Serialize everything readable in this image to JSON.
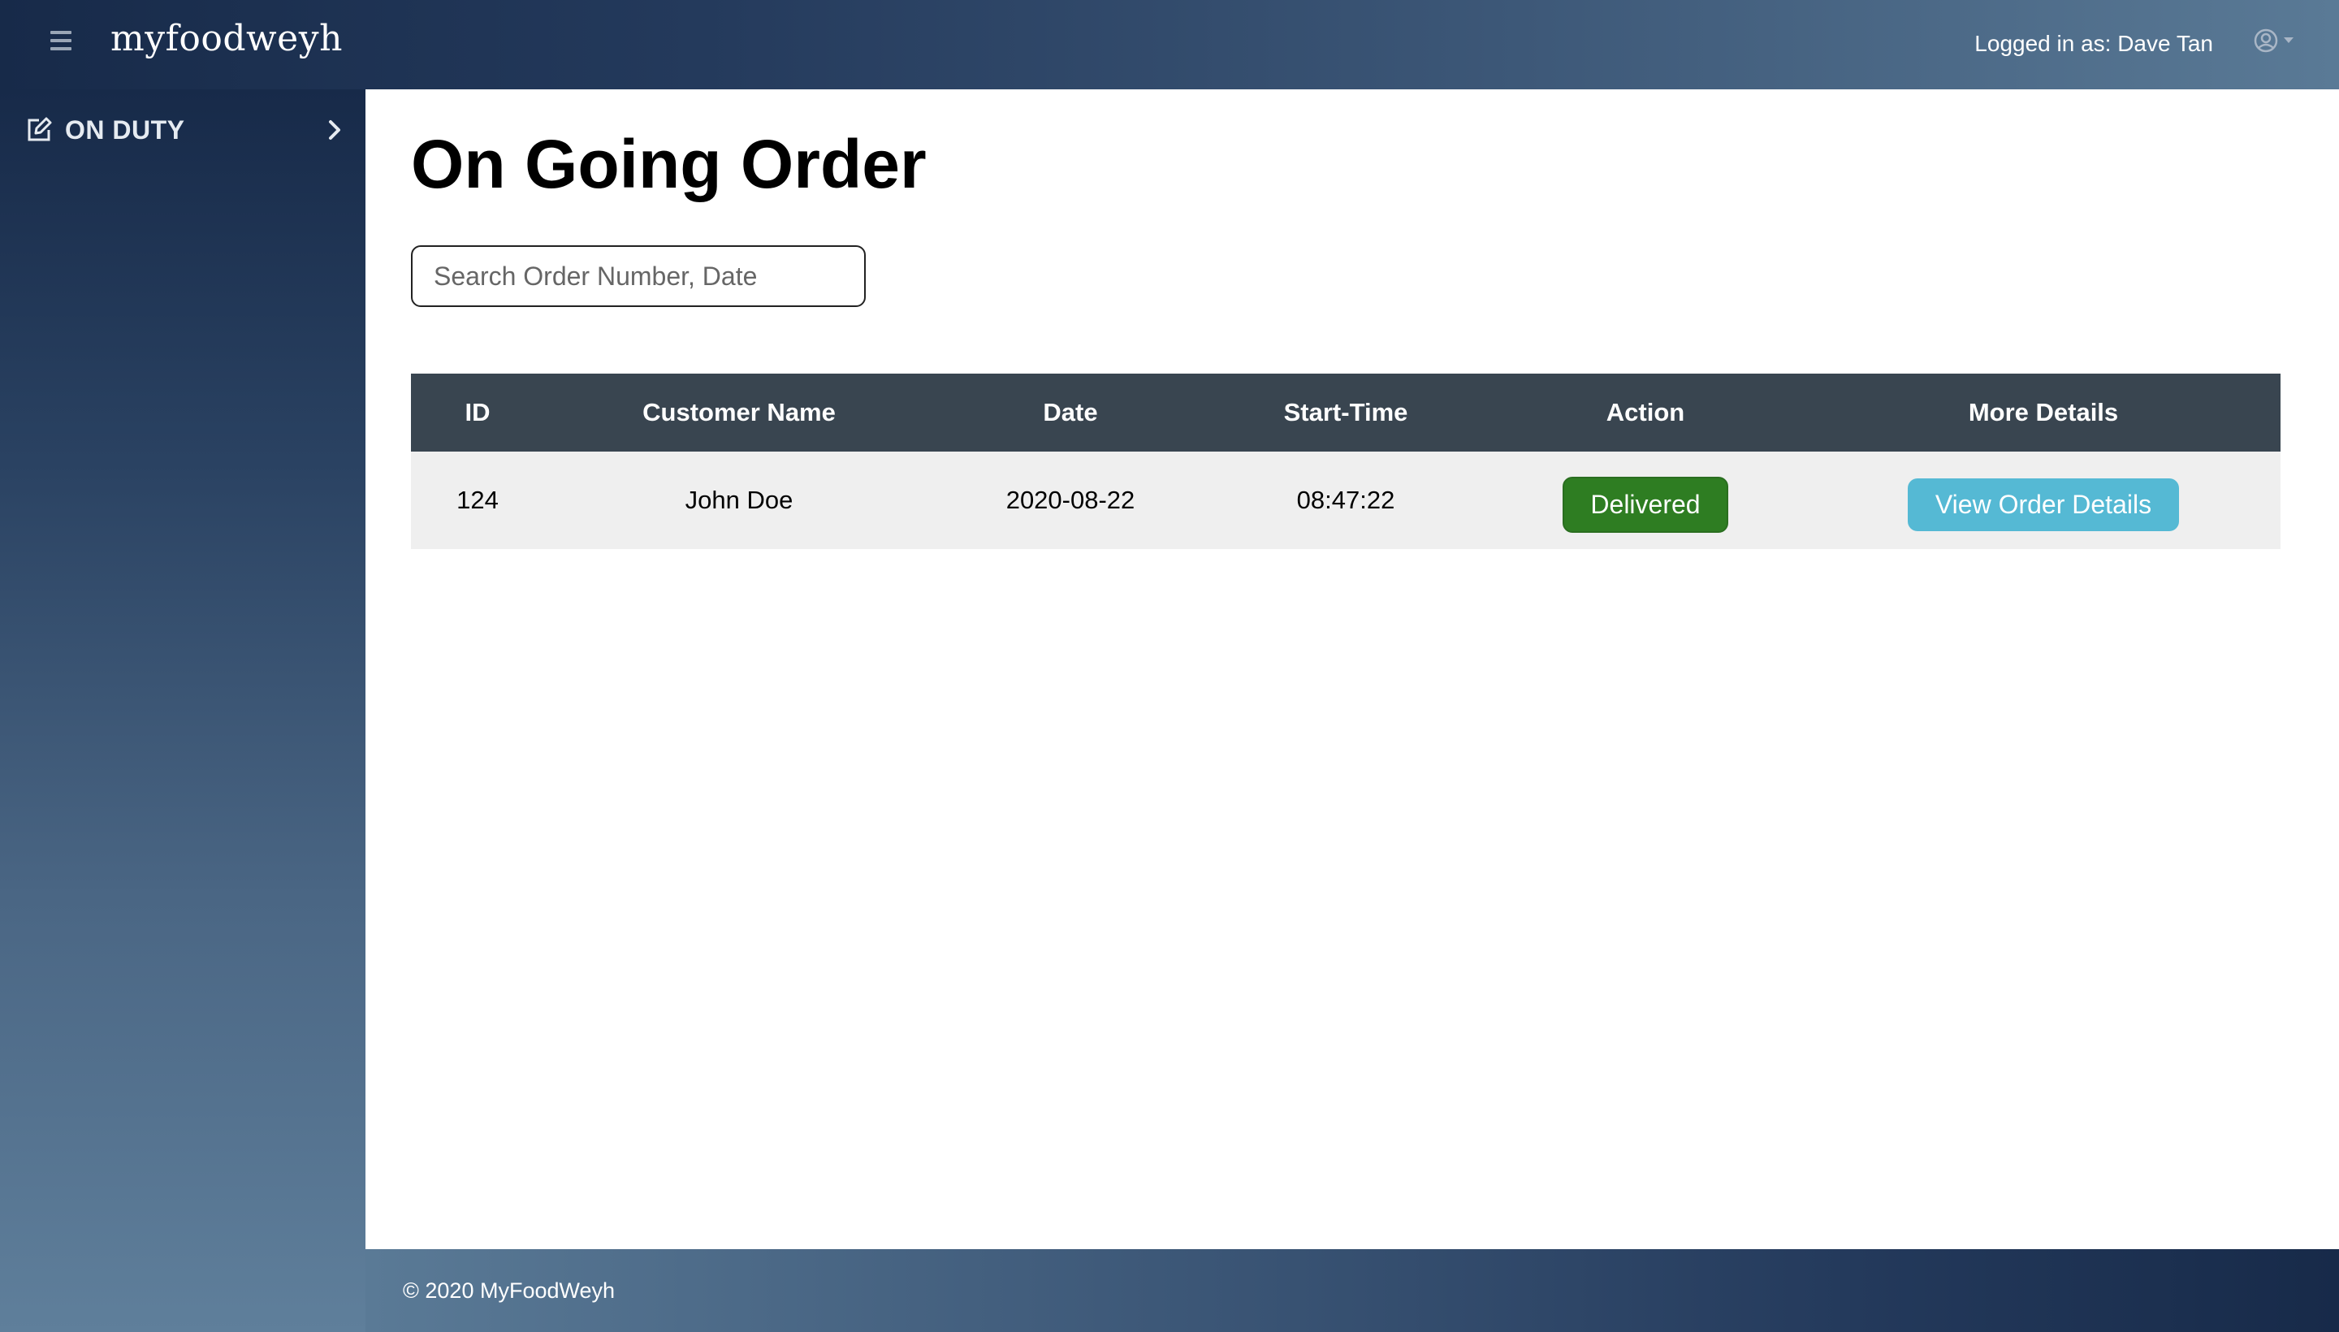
{
  "header": {
    "brand": "myfoodweyh",
    "logged_in_text": "Logged in as: Dave Tan"
  },
  "sidebar": {
    "items": [
      {
        "label": "ON DUTY",
        "icon": "edit-icon"
      }
    ]
  },
  "main": {
    "title": "On Going Order",
    "search_placeholder": "Search Order Number, Date",
    "table": {
      "columns": [
        "ID",
        "Customer Name",
        "Date",
        "Start-Time",
        "Action",
        "More Details"
      ],
      "rows": [
        {
          "id": "124",
          "customer_name": "John Doe",
          "date": "2020-08-22",
          "start_time": "08:47:22",
          "action_label": "Delivered",
          "details_label": "View Order Details"
        }
      ]
    }
  },
  "footer": {
    "copyright": "© 2020 MyFoodWeyh"
  },
  "colors": {
    "header_start": "#172a49",
    "header_end": "#5a7a96",
    "table_header": "#394550",
    "delivered_button": "#2e7d22",
    "details_button": "#55b9d4"
  }
}
